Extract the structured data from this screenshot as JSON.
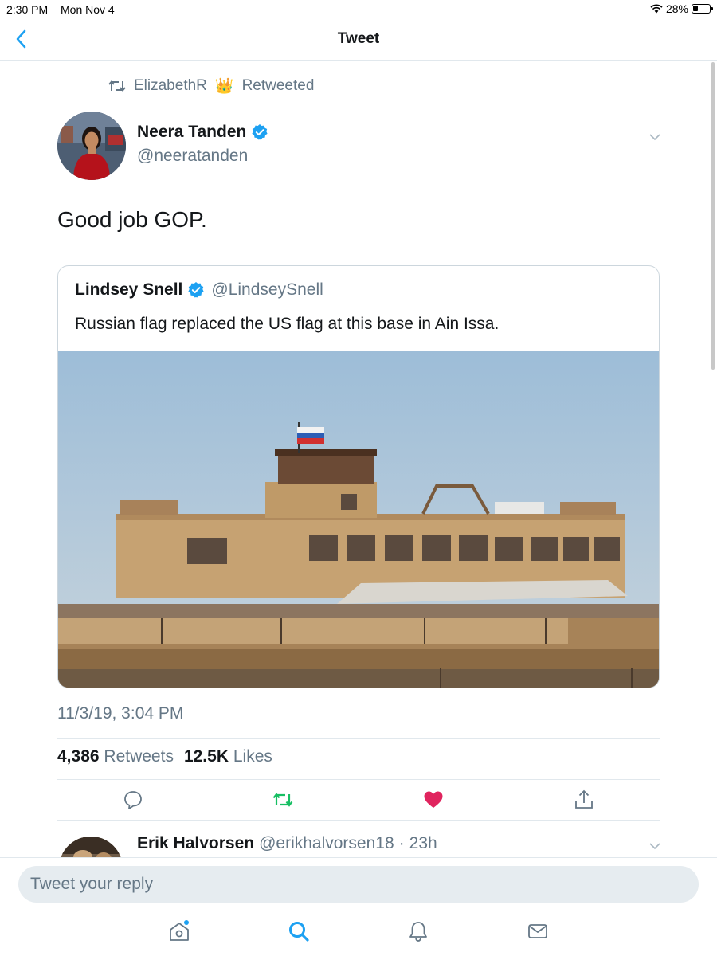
{
  "status_bar": {
    "time": "2:30 PM",
    "date": "Mon Nov 4",
    "battery": "28%"
  },
  "nav": {
    "title": "Tweet",
    "back_icon": "chevron-left-icon"
  },
  "retweet_context": {
    "user": "ElizabethR",
    "emoji": "👑",
    "action": "Retweeted"
  },
  "tweet": {
    "author_name": "Neera Tanden",
    "author_handle": "@neeratanden",
    "verified": true,
    "text": "Good job GOP.",
    "timestamp": "11/3/19, 3:04 PM",
    "retweets_count": "4,386",
    "retweets_label": "Retweets",
    "likes_count": "12.5K",
    "likes_label": "Likes",
    "liked": true
  },
  "quote": {
    "author_name": "Lindsey Snell",
    "author_handle": "@LindseySnell",
    "verified": true,
    "text": "Russian flag replaced the US flag at this base in Ain Issa."
  },
  "actions": [
    "reply-icon",
    "retweet-icon",
    "like-icon",
    "share-icon"
  ],
  "reply_preview": {
    "name": "Erik Halvorsen",
    "handle": "@erikhalvorsen18",
    "separator": "·",
    "time": "23h"
  },
  "reply_box": {
    "placeholder": "Tweet your reply"
  },
  "tab_bar": [
    "home-icon",
    "search-icon",
    "notifications-icon",
    "messages-icon"
  ],
  "colors": {
    "accent": "#1da1f2",
    "retweet_green": "#17bf63",
    "like_red": "#e0245e",
    "muted": "#657786",
    "divider": "#e1e8ed"
  }
}
